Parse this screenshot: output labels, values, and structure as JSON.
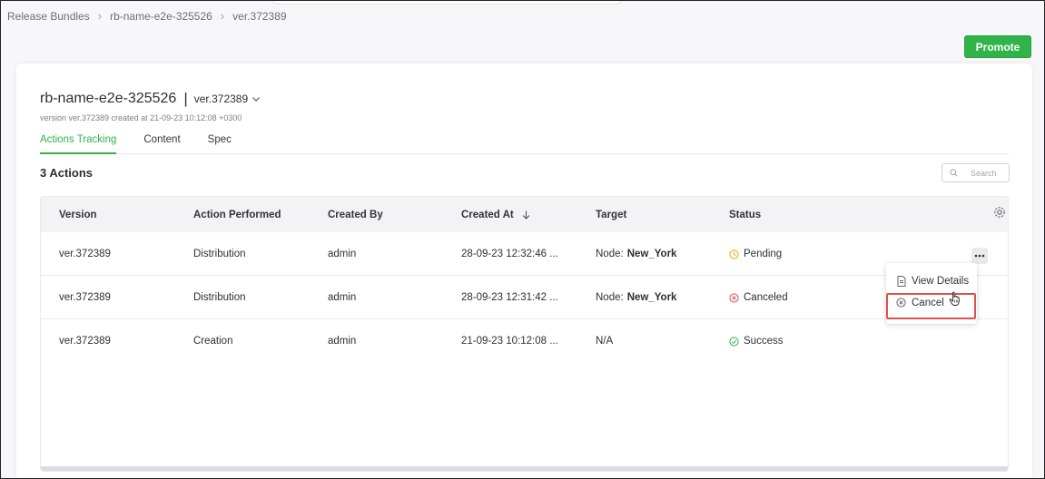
{
  "breadcrumb": [
    "Release Bundles",
    "rb-name-e2e-325526",
    "ver.372389"
  ],
  "promote_label": "Promote",
  "bundle": {
    "name": "rb-name-e2e-325526",
    "version": "ver.372389",
    "subtitle": "version ver.372389 created at 21-09-23 10:12:08 +0300"
  },
  "tabs": [
    {
      "label": "Actions Tracking",
      "active": true
    },
    {
      "label": "Content",
      "active": false
    },
    {
      "label": "Spec",
      "active": false
    }
  ],
  "actions_count": "3 Actions",
  "search": {
    "placeholder": "Search"
  },
  "table": {
    "columns": [
      "Version",
      "Action Performed",
      "Created By",
      "Created At",
      "Target",
      "Status"
    ],
    "sort_column": "Created At",
    "rows": [
      {
        "version": "ver.372389",
        "action": "Distribution",
        "created_by": "admin",
        "created_at": "28-09-23 12:32:46 ...",
        "target_prefix": "Node:",
        "target_value": "New_York",
        "status": "Pending",
        "status_icon": "clock-icon",
        "status_color": "#f0a500"
      },
      {
        "version": "ver.372389",
        "action": "Distribution",
        "created_by": "admin",
        "created_at": "28-09-23 12:31:42 ...",
        "target_prefix": "Node:",
        "target_value": "New_York",
        "status": "Canceled",
        "status_icon": "x-circle-icon",
        "status_color": "#e0504b"
      },
      {
        "version": "ver.372389",
        "action": "Creation",
        "created_by": "admin",
        "created_at": "21-09-23 10:12:08 ...",
        "target_prefix": "N/A",
        "target_value": "",
        "status": "Success",
        "status_icon": "check-circle-icon",
        "status_color": "#30b44a"
      }
    ]
  },
  "context_menu": {
    "view_details": "View Details",
    "cancel": "Cancel"
  },
  "colors": {
    "accent": "#30b44a",
    "highlight": "#e0504b"
  }
}
